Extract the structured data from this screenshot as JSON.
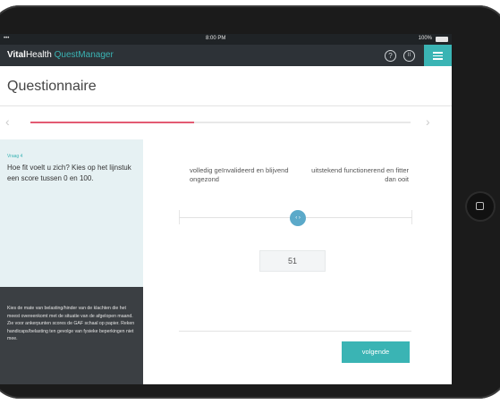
{
  "device": {
    "home_button": "home-button"
  },
  "status_bar": {
    "carrier": "•••",
    "time": "8:00 PM",
    "battery": "100%"
  },
  "app_bar": {
    "brand_part1": "Vital",
    "brand_part2": "Health",
    "brand_part3": " QuestManager",
    "help_icon": "?",
    "pause_icon": "II",
    "menu_icon": "hamburger-menu"
  },
  "page": {
    "title": "Questionnaire"
  },
  "progress": {
    "prev": "‹",
    "next": "›",
    "value": 0.43
  },
  "question": {
    "label": "Vraag 4",
    "text": "Hoe fit voelt u zich? Kies op het lijnstuk een score tussen 0 en 100."
  },
  "info": {
    "text": "Kies de mate van belasting/hinder van de klachten die het meest overeenkomt met de situatie van de afgelopen maand. Zie voor ankerpunten scores de GAF schaal op papier. Reken handicaps/belasting ten gevolge van fysieke beperkingen niet mee."
  },
  "slider": {
    "left_label": "volledig geïnvalideerd en blijvend ongezond",
    "right_label": "uitstekend functionerend en fitter dan ooit",
    "knob_glyph": "‹ ›",
    "value": 51
  },
  "score": {
    "value": "51"
  },
  "actions": {
    "next_label": "volgende"
  },
  "colors": {
    "accent": "#3ab4b4",
    "progress": "#e35a72",
    "dark": "#2d3237"
  }
}
